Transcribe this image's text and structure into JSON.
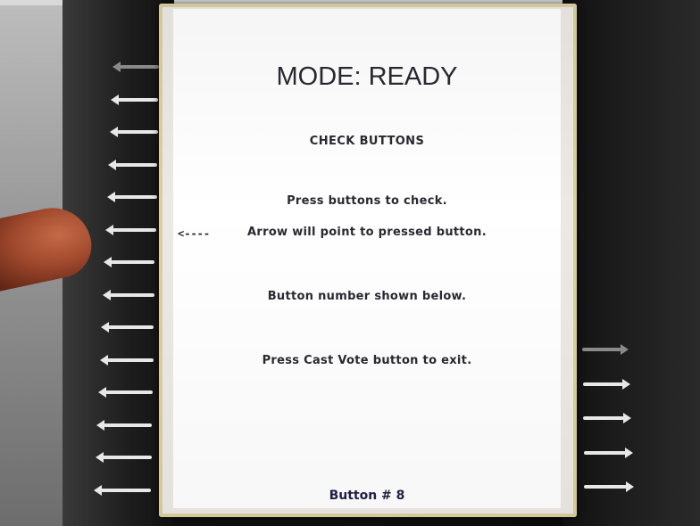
{
  "screen": {
    "mode_title": "MODE: READY",
    "heading": "CHECK BUTTONS",
    "instructions": [
      "Press buttons to check.",
      "Arrow will point to pressed button.",
      "Button number shown below.",
      "Press Cast Vote button to exit."
    ],
    "pointer_indicator": "<----",
    "button_number": "Button # 8"
  },
  "hardware": {
    "left_buttons_count": 14,
    "right_buttons_count": 5,
    "pressed_button": 8
  },
  "colors": {
    "screen_background": "#ffffff",
    "screen_text": "#2a2830",
    "button_number_text": "#232046",
    "bezel": "#1a1a1a"
  }
}
